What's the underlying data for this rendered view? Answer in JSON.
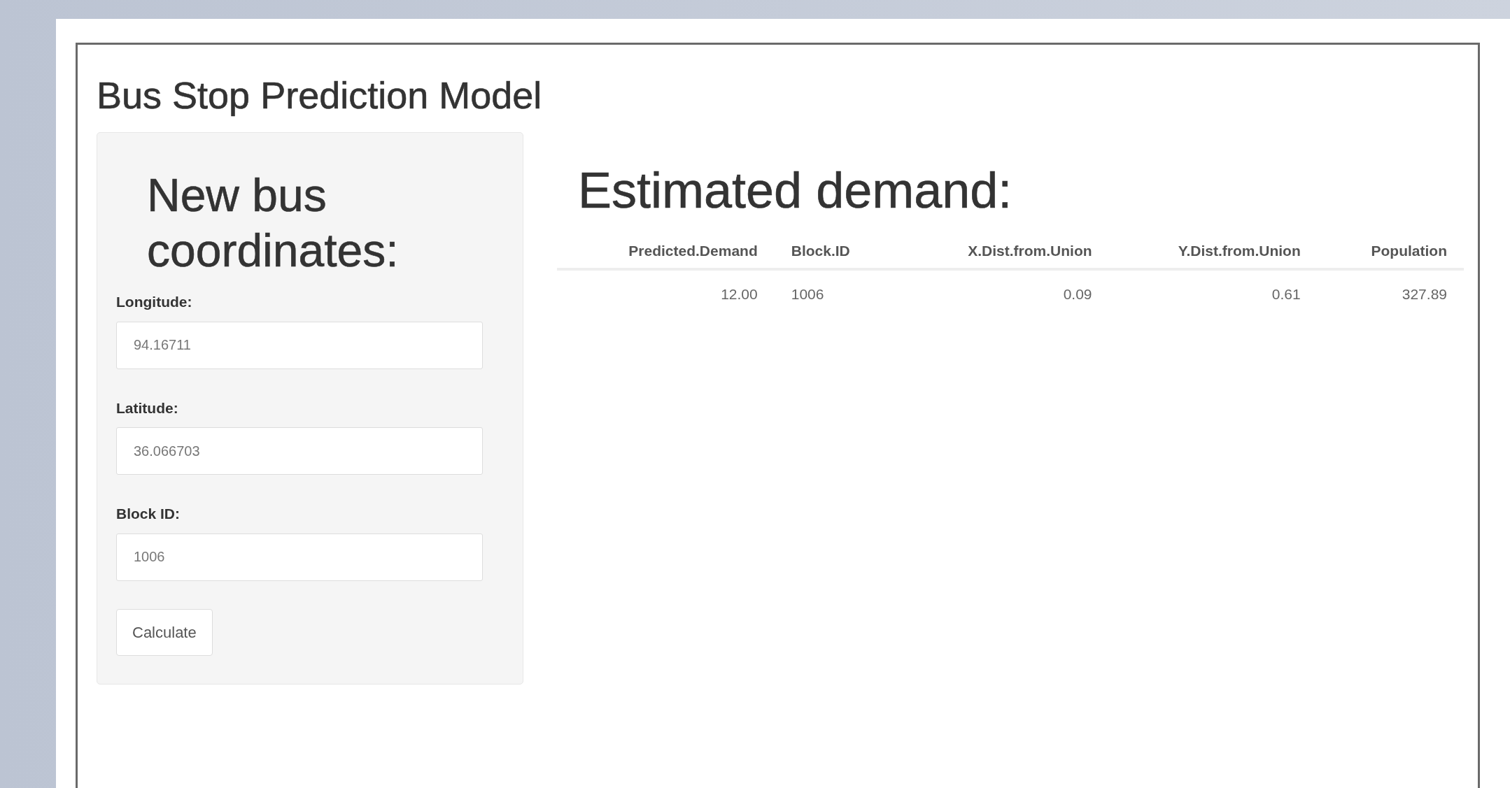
{
  "title": "Bus Stop Prediction Model",
  "sidebar": {
    "heading": "New bus coordinates:",
    "fields": [
      {
        "label": "Longitude:",
        "value": "94.16711"
      },
      {
        "label": "Latitude:",
        "value": "36.066703"
      },
      {
        "label": "Block ID:",
        "value": "1006"
      }
    ],
    "button": "Calculate"
  },
  "main": {
    "heading": "Estimated demand:",
    "table": {
      "columns": [
        {
          "label": "Predicted.Demand",
          "kind": "number"
        },
        {
          "label": "Block.ID",
          "kind": "text"
        },
        {
          "label": "X.Dist.from.Union",
          "kind": "number"
        },
        {
          "label": "Y.Dist.from.Union",
          "kind": "number"
        },
        {
          "label": "Population",
          "kind": "number"
        }
      ],
      "rows": [
        [
          "12.00",
          "1006",
          "0.09",
          "0.61",
          "327.89"
        ]
      ]
    }
  }
}
